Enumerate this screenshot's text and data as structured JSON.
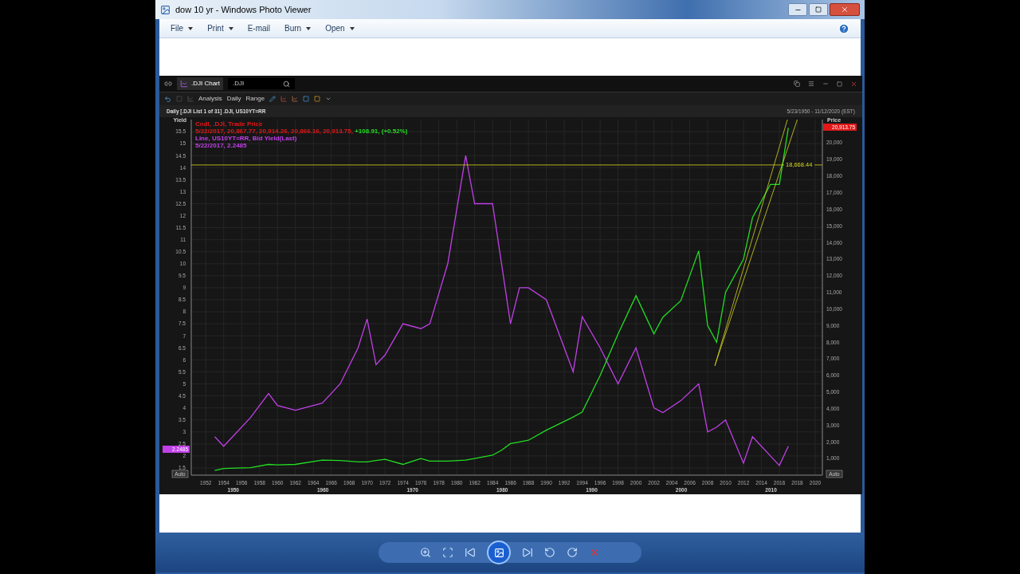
{
  "window": {
    "title": "dow 10 yr - Windows Photo Viewer"
  },
  "menu": [
    {
      "label": "File",
      "caret": true
    },
    {
      "label": "Print",
      "caret": true
    },
    {
      "label": "E-mail",
      "caret": false
    },
    {
      "label": "Burn",
      "caret": true
    },
    {
      "label": "Open",
      "caret": true
    }
  ],
  "photo": {
    "tab": {
      "label": ".DJI Chart"
    },
    "search": {
      "value": ".DJI"
    },
    "toolbar": [
      {
        "label": "Analysis"
      },
      {
        "label": "Daily"
      },
      {
        "label": "Range"
      }
    ],
    "chart_title": "Daily [.DJI List 1 of 31] .DJI, US10YT=RR",
    "date_range": "5/23/1950 - 11/12/2020 (EST)",
    "left_axis_title": "Yield",
    "right_axis_title": "Price",
    "legend": [
      {
        "text": "Cndl, .DJI, Trade Price",
        "color": "#e01818"
      },
      {
        "text": "5/22/2017, 20,867.77, 20,914.26, 20,866.16, 20,913.75,",
        "color": "#e01818",
        "change": "+108.91, (+0.52%)"
      },
      {
        "text": "Line, US10YT=RR, Bid Yield(Last)",
        "color": "#c040e8"
      },
      {
        "text": "5/22/2017, 2.2485",
        "color": "#c040e8"
      }
    ],
    "yield_badge": "2.2485",
    "price_badge": "20,913.75",
    "auto_buttons": [
      "Auto",
      "Auto"
    ],
    "decades": [
      "1950",
      "1960",
      "1970",
      "1980",
      "1990",
      "2000",
      "2010"
    ],
    "chart_data": {
      "type": "line",
      "x": [
        1953,
        1954,
        1957,
        1959,
        1960,
        1962,
        1965,
        1967,
        1969,
        1970,
        1971,
        1972,
        1974,
        1976,
        1977,
        1979,
        1981,
        1982,
        1984,
        1985,
        1986,
        1987,
        1988,
        1990,
        1993,
        1994,
        1996,
        1998,
        2000,
        2002,
        2003,
        2005,
        2007,
        2008,
        2009,
        2010,
        2012,
        2013,
        2015,
        2016,
        2017
      ],
      "series": [
        {
          "color": "#c040e8",
          "values": [
            2.8,
            2.4,
            3.6,
            4.6,
            4.1,
            3.9,
            4.2,
            5.0,
            6.5,
            7.7,
            5.8,
            6.2,
            7.5,
            7.3,
            7.5,
            10,
            14.5,
            12.5,
            12.5,
            10,
            7.5,
            9,
            9,
            8.5,
            5.5,
            7.8,
            6.5,
            5,
            6.5,
            4,
            3.8,
            4.3,
            5,
            3,
            3.2,
            3.5,
            1.7,
            2.8,
            2,
            1.6,
            2.4
          ]
        },
        {
          "color": "#22dd22",
          "axis": "y2",
          "values": [
            280,
            400,
            450,
            650,
            620,
            650,
            900,
            880,
            800,
            800,
            880,
            950,
            650,
            1000,
            850,
            850,
            900,
            1000,
            1200,
            1500,
            1900,
            2000,
            2100,
            2700,
            3500,
            3800,
            6000,
            8500,
            10800,
            8500,
            9500,
            10500,
            13500,
            9000,
            8000,
            11000,
            13000,
            15500,
            17500,
            17500,
            20900
          ]
        }
      ],
      "xlim": [
        1950.2,
        2020.8
      ],
      "ylim": [
        1.2,
        16
      ],
      "y2lim": [
        0,
        21400
      ],
      "grid": true,
      "ref_lines": [
        {
          "value": 18668.44,
          "axis": "y2",
          "label": "18,668.44",
          "color": "#d8d820"
        }
      ],
      "xticks": [
        1952,
        1954,
        1956,
        1958,
        1960,
        1962,
        1964,
        1966,
        1968,
        1970,
        1972,
        1974,
        1976,
        1978,
        1980,
        1982,
        1984,
        1986,
        1988,
        1990,
        1992,
        1994,
        1996,
        1998,
        2000,
        2002,
        2004,
        2006,
        2008,
        2010,
        2012,
        2014,
        2016,
        2018,
        2020
      ],
      "yticks": [
        15.5,
        15,
        14.5,
        14,
        13.5,
        13,
        12.5,
        12,
        11.5,
        11,
        10.5,
        10,
        9.5,
        9,
        8.5,
        8,
        7.5,
        7,
        6.5,
        6,
        5.5,
        5,
        4.5,
        4,
        3.5,
        3,
        2.5,
        2,
        1.5
      ],
      "y2ticks": [
        {
          "value": 20000,
          "label": "20,000"
        },
        {
          "value": 19000,
          "label": "19,000"
        },
        {
          "value": 18000,
          "label": "18,000"
        },
        {
          "value": 17000,
          "label": "17,000"
        },
        {
          "value": 16000,
          "label": "16,000"
        },
        {
          "value": 15000,
          "label": "15,000"
        },
        {
          "value": 14000,
          "label": "14,000"
        },
        {
          "value": 13000,
          "label": "13,000"
        },
        {
          "value": 12000,
          "label": "12,000"
        },
        {
          "value": 11000,
          "label": "11,000"
        },
        {
          "value": 10000,
          "label": "10,000"
        },
        {
          "value": 9000,
          "label": "9,000"
        },
        {
          "value": 8000,
          "label": "8,000"
        },
        {
          "value": 7000,
          "label": "7,000"
        },
        {
          "value": 6000,
          "label": "6,000"
        },
        {
          "value": 5000,
          "label": "5,000"
        },
        {
          "value": 4000,
          "label": "4,000"
        },
        {
          "value": 3000,
          "label": "3,000"
        },
        {
          "value": 2000,
          "label": "2,000"
        },
        {
          "value": 1000,
          "label": "1,000"
        }
      ]
    }
  }
}
